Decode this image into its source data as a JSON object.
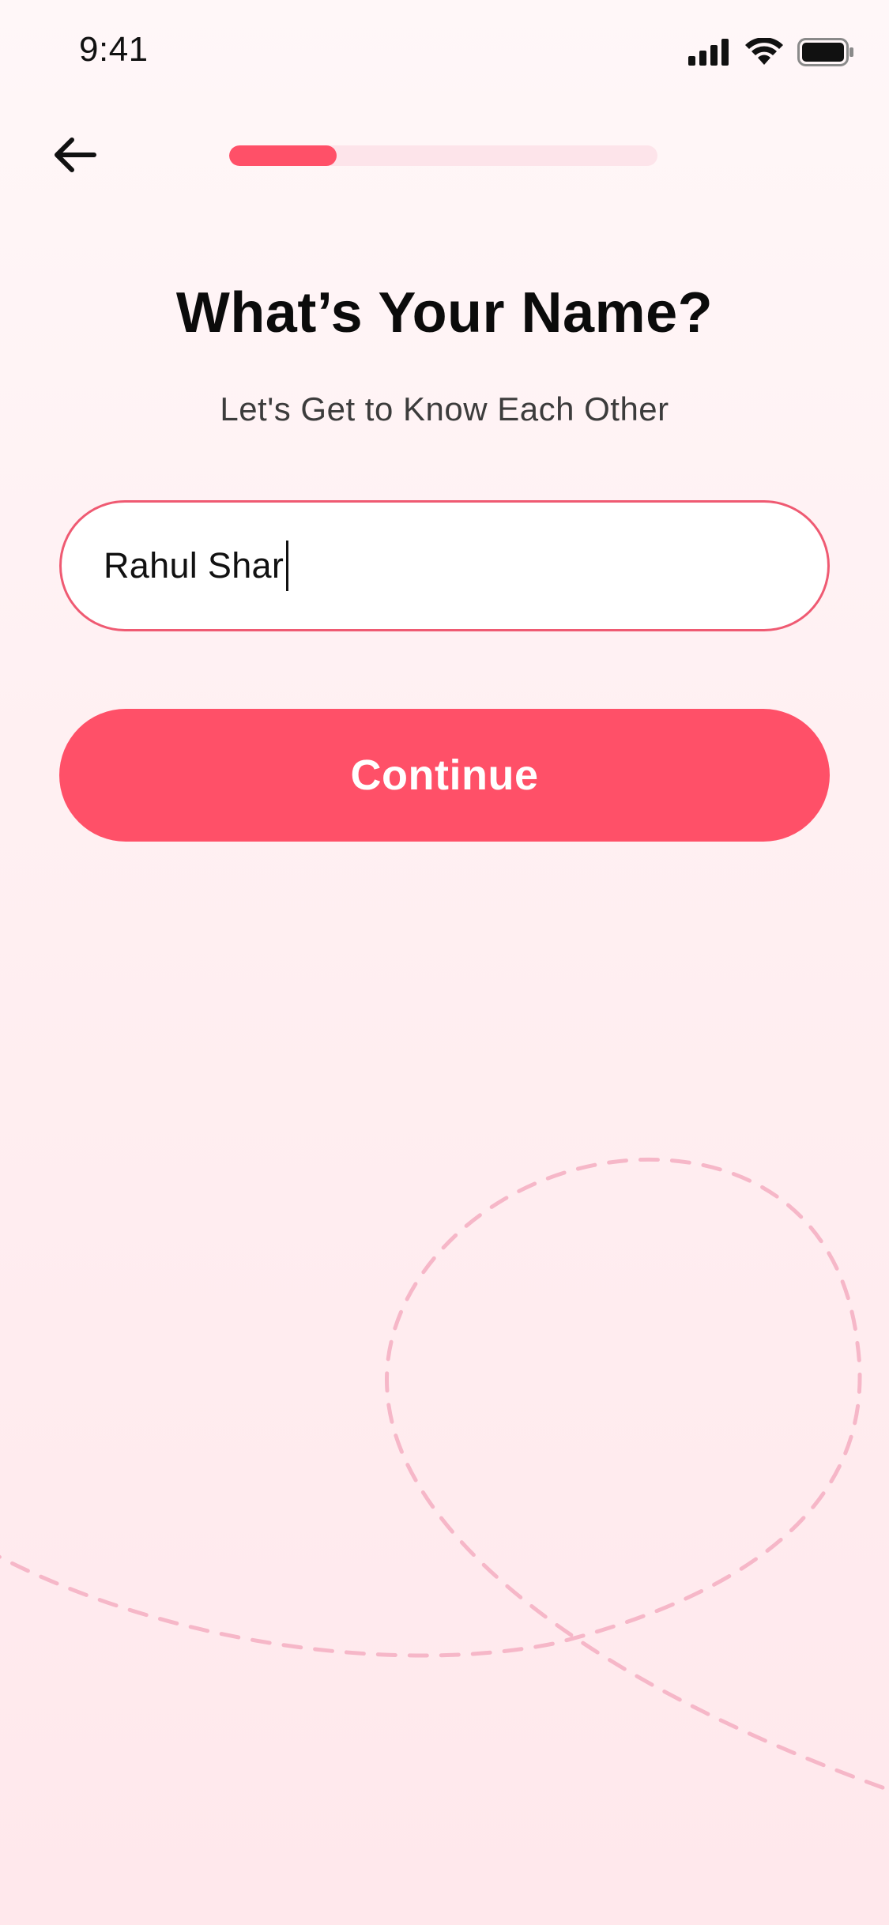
{
  "status_bar": {
    "time": "9:41",
    "icons": [
      "cellular-signal-icon",
      "wifi-icon",
      "battery-icon"
    ]
  },
  "header": {
    "back_icon": "arrow-left-icon",
    "progress": {
      "value": 0.25,
      "fill_color": "#ff5068",
      "track_color": "#fde4ea"
    }
  },
  "main": {
    "title": "What’s Your Name?",
    "subtitle": "Let's Get to Know Each Other",
    "name_field": {
      "value": "Rahul Shar",
      "focused": true,
      "border_color": "#ef5a72"
    },
    "continue_label": "Continue"
  },
  "colors": {
    "accent": "#ff5068",
    "decor_dash": "#f6b7c8"
  }
}
